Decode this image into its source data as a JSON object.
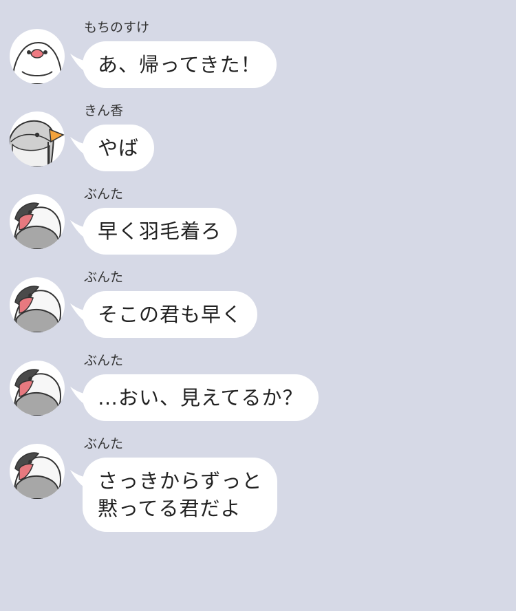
{
  "chat": {
    "background_color": "#d6d9e6",
    "bubble_color": "#ffffff",
    "messages": [
      {
        "sender": "もちのすけ",
        "avatar_icon": "white-java-sparrow-icon",
        "text": "あ、帰ってきた！"
      },
      {
        "sender": "きん香",
        "avatar_icon": "gray-bird-icon",
        "text": "やば"
      },
      {
        "sender": "ぶんた",
        "avatar_icon": "java-sparrow-icon",
        "text": "早く羽毛着ろ"
      },
      {
        "sender": "ぶんた",
        "avatar_icon": "java-sparrow-icon",
        "text": "そこの君も早く"
      },
      {
        "sender": "ぶんた",
        "avatar_icon": "java-sparrow-icon",
        "text": "…おい、見えてるか？"
      },
      {
        "sender": "ぶんた",
        "avatar_icon": "java-sparrow-icon",
        "text": "さっきからずっと\n黙ってる君だよ"
      }
    ]
  }
}
